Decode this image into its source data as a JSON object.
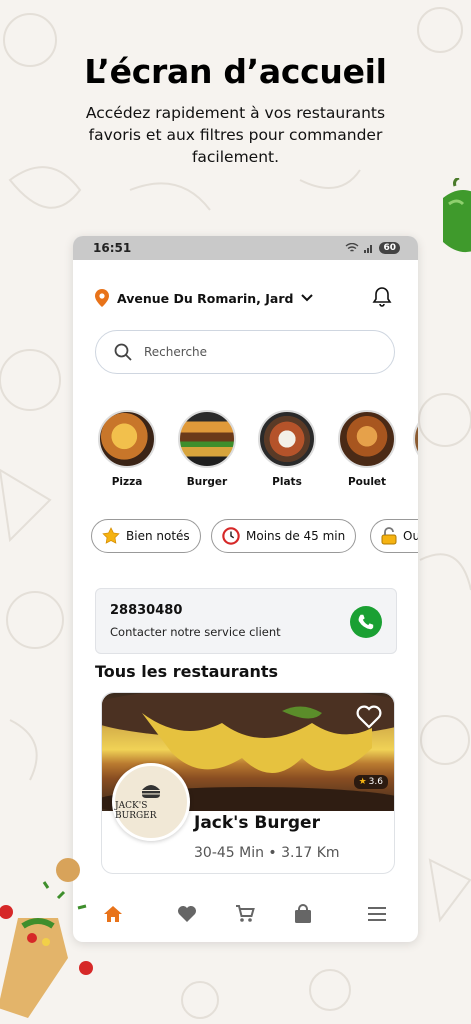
{
  "hero": {
    "title": "L’écran d’accueil",
    "subtitle": "Accédez rapidement à vos restaurants favoris et aux filtres pour commander facilement."
  },
  "status_bar": {
    "time": "16:51",
    "battery": "60"
  },
  "location": {
    "address": "Avenue Du Romarin, Jardin"
  },
  "search": {
    "placeholder": "Recherche"
  },
  "categories": [
    {
      "label": "Pizza"
    },
    {
      "label": "Burger"
    },
    {
      "label": "Plats"
    },
    {
      "label": "Poulet"
    }
  ],
  "filters": [
    {
      "label": "Bien notés",
      "icon": "star-icon"
    },
    {
      "label": "Moins de 45 min",
      "icon": "clock-icon"
    },
    {
      "label": "Ou",
      "icon": "lock-open-icon"
    }
  ],
  "contact": {
    "number": "28830480",
    "text": "Contacter notre service client"
  },
  "section": {
    "title": "Tous les restaurants"
  },
  "restaurant": {
    "name": "Jack's Burger",
    "meta": "30-45 Min • 3.17 Km",
    "rating": "3.6",
    "logo_text": "JACK'S BURGER"
  },
  "tabbar": [
    "home-icon",
    "heart-icon",
    "cart-icon",
    "bag-icon",
    "menu-icon"
  ],
  "colors": {
    "accent": "#e8731a",
    "call": "#1aa033",
    "text": "#111111"
  }
}
